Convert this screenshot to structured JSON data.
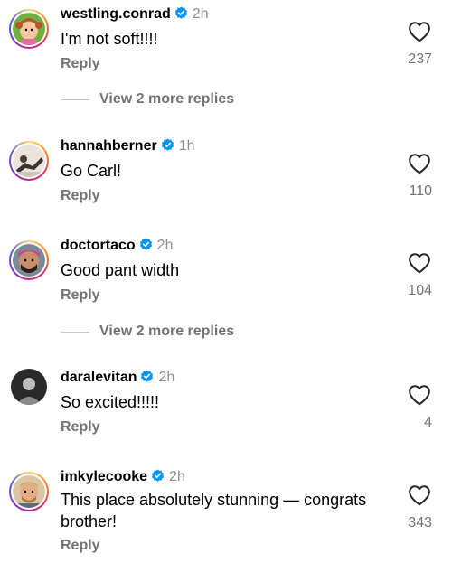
{
  "colors": {
    "verified": "#0095f6",
    "muted": "#737373",
    "time": "#8e8e8e"
  },
  "comments": [
    {
      "username": "westling.conrad",
      "verified": true,
      "time": "2h",
      "text": "I'm not soft!!!!",
      "reply": "Reply",
      "likes": "237",
      "avatar": "cartoon-girl-avatar"
    },
    {
      "username": "hannahberner",
      "verified": true,
      "time": "1h",
      "text": "Go Carl!",
      "reply": "Reply",
      "likes": "110",
      "avatar": "person-avatar"
    },
    {
      "username": "doctortaco",
      "verified": true,
      "time": "2h",
      "text": "Good pant width",
      "reply": "Reply",
      "likes": "104",
      "avatar": "bearded-man-avatar"
    },
    {
      "username": "daralevitan",
      "verified": true,
      "time": "2h",
      "text": "So excited!!!!!",
      "reply": "Reply",
      "likes": "4",
      "avatar": "bw-avatar"
    },
    {
      "username": "imkylecooke",
      "verified": true,
      "time": "2h",
      "text": "This place absolutely stunning — congrats brother!",
      "reply": "Reply",
      "likes": "343",
      "avatar": "blond-man-avatar"
    }
  ],
  "more_replies": [
    {
      "label": "View 2 more replies"
    },
    {
      "label": "View 2 more replies"
    }
  ]
}
